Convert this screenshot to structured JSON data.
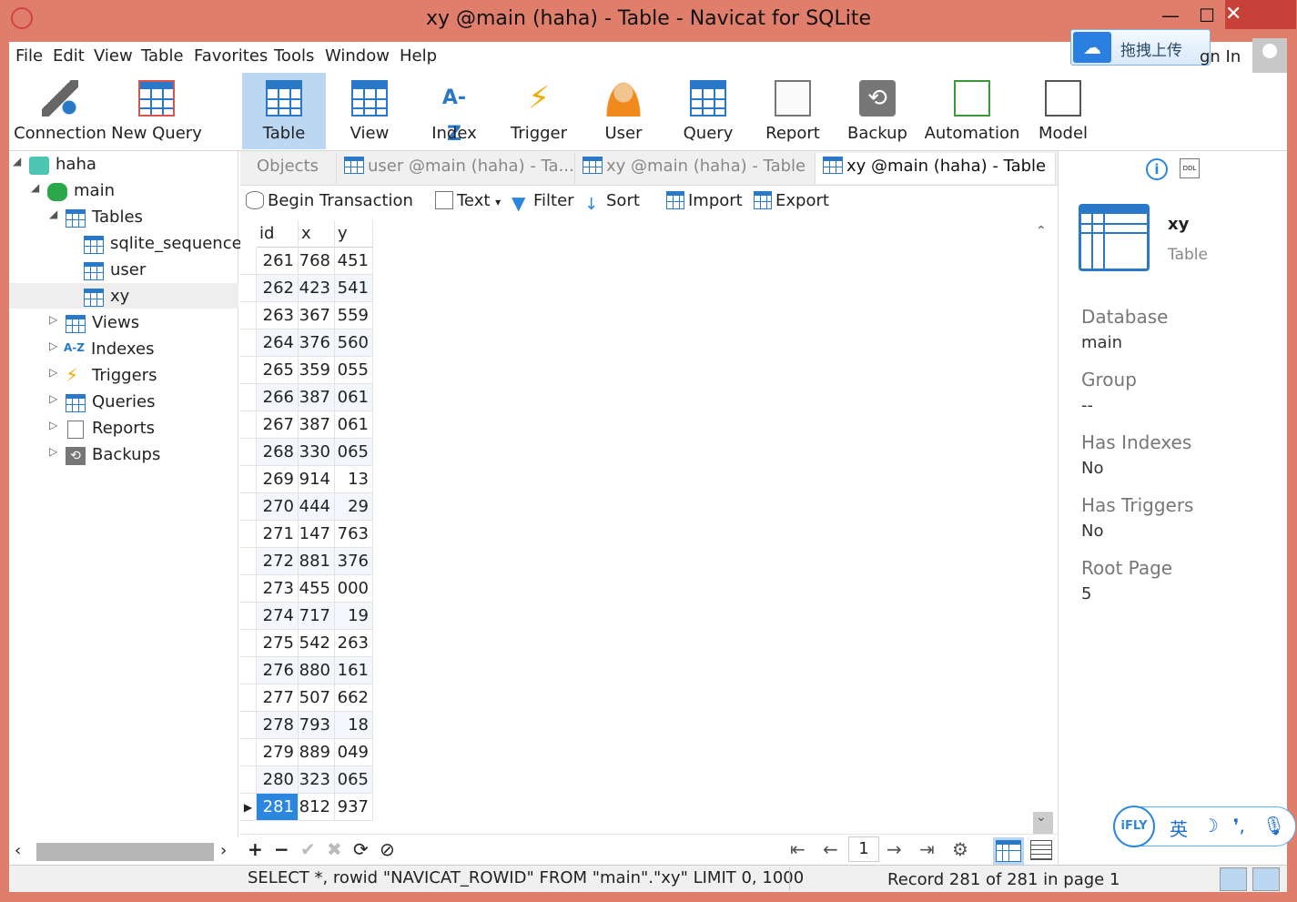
{
  "window": {
    "title": "xy @main (haha) - Table - Navicat for SQLite",
    "minimize": "—",
    "maximize": "☐",
    "close": "✕"
  },
  "menu": [
    "File",
    "Edit",
    "View",
    "Table",
    "Favorites",
    "Tools",
    "Window",
    "Help"
  ],
  "upload": {
    "label": "拖拽上传",
    "signin": "gn In"
  },
  "toolbar": [
    {
      "label": "Connection",
      "icon": "connection-icon"
    },
    {
      "label": "New Query",
      "icon": "new-query-icon"
    },
    {
      "label": "Table",
      "icon": "table-icon",
      "active": true
    },
    {
      "label": "View",
      "icon": "view-icon"
    },
    {
      "label": "Index",
      "icon": "index-icon",
      "glyph": "A-Z"
    },
    {
      "label": "Trigger",
      "icon": "trigger-icon",
      "glyph": "⚡"
    },
    {
      "label": "User",
      "icon": "user-icon"
    },
    {
      "label": "Query",
      "icon": "query-icon"
    },
    {
      "label": "Report",
      "icon": "report-icon"
    },
    {
      "label": "Backup",
      "icon": "backup-icon",
      "glyph": "⟲"
    },
    {
      "label": "Automation",
      "icon": "automation-icon"
    },
    {
      "label": "Model",
      "icon": "model-icon"
    }
  ],
  "nav": {
    "connection": "haha",
    "database": "main",
    "tables": "Tables",
    "table_items": [
      "sqlite_sequence",
      "user",
      "xy"
    ],
    "groups": [
      "Views",
      "Indexes",
      "Triggers",
      "Queries",
      "Reports",
      "Backups"
    ],
    "index_glyph": "A-Z",
    "trigger_glyph": "⚡",
    "backup_glyph": "⟲"
  },
  "tabs": [
    "Objects",
    "user @main (haha) - Ta...",
    "xy @main (haha) - Table",
    "xy @main (haha) - Table"
  ],
  "subtoolbar": {
    "begin": "Begin Transaction",
    "text": "Text",
    "filter": "Filter",
    "sort": "Sort",
    "import": "Import",
    "export": "Export",
    "dropdown": "▾"
  },
  "grid": {
    "columns": [
      "id",
      "x",
      "y"
    ],
    "rows": [
      [
        "261",
        "768",
        "451"
      ],
      [
        "262",
        "423",
        "541"
      ],
      [
        "263",
        "367",
        "559"
      ],
      [
        "264",
        "376",
        "560"
      ],
      [
        "265",
        "359",
        "055"
      ],
      [
        "266",
        "387",
        "061"
      ],
      [
        "267",
        "387",
        "061"
      ],
      [
        "268",
        "330",
        "065"
      ],
      [
        "269",
        "914",
        "13"
      ],
      [
        "270",
        "444",
        "29"
      ],
      [
        "271",
        "147",
        "763"
      ],
      [
        "272",
        "881",
        "376"
      ],
      [
        "273",
        "455",
        "000"
      ],
      [
        "274",
        "717",
        "19"
      ],
      [
        "275",
        "542",
        "263"
      ],
      [
        "276",
        "880",
        "161"
      ],
      [
        "277",
        "507",
        "662"
      ],
      [
        "278",
        "793",
        "18"
      ],
      [
        "279",
        "889",
        "049"
      ],
      [
        "280",
        "323",
        "065"
      ],
      [
        "281",
        "812",
        "937"
      ]
    ],
    "selected_row": 20,
    "current_marker": "▶"
  },
  "gridbar": {
    "add": "+",
    "remove": "−",
    "apply": "✔",
    "discard": "✖",
    "refresh": "⟳",
    "stop": "⊘",
    "first": "⇤",
    "prev": "←",
    "page": "1",
    "next": "→",
    "last": "⇥",
    "settings": "⚙"
  },
  "info": {
    "name": "xy",
    "type": "Table",
    "props": [
      {
        "label": "Database",
        "value": "main"
      },
      {
        "label": "Group",
        "value": "--"
      },
      {
        "label": "Has Indexes",
        "value": "No"
      },
      {
        "label": "Has Triggers",
        "value": "No"
      },
      {
        "label": "Root Page",
        "value": "5"
      }
    ],
    "info_glyph": "i",
    "ddl_glyph": "DDL"
  },
  "status": {
    "sql": "SELECT *, rowid \"NAVICAT_ROWID\" FROM \"main\".\"xy\" LIMIT 0, 1000",
    "record": "Record 281 of 281 in page 1"
  },
  "ifly": {
    "logo": "iFLY",
    "lang": "英",
    "moon": "☽",
    "punct": "❜,",
    "mic": "🎙"
  },
  "scroll": {
    "up": "⌃",
    "down": "⌄",
    "left": "‹",
    "right": "›"
  }
}
